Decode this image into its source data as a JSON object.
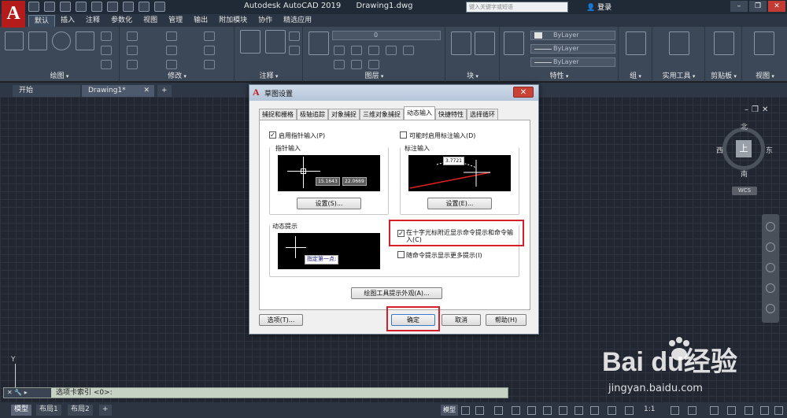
{
  "app": {
    "title_app": "Autodesk AutoCAD 2019",
    "title_file": "Drawing1.dwg",
    "search_placeholder": "键入关键字或短语",
    "login": "登录"
  },
  "ribbon_tabs": [
    "默认",
    "插入",
    "注释",
    "参数化",
    "视图",
    "管理",
    "输出",
    "附加模块",
    "协作",
    "精选应用"
  ],
  "ribbon_panels": {
    "draw": "绘图",
    "modify": "修改",
    "annotation": "注释",
    "layers": "图层",
    "block": "块",
    "properties": "特性",
    "groups": "组",
    "utilities": "实用工具",
    "clipboard": "剪贴板",
    "view": "视图",
    "layer_value": "0",
    "bylayer": "ByLayer"
  },
  "doc_tabs": {
    "start": "开始",
    "drawing": "Drawing1*"
  },
  "viewcube": {
    "face": "上",
    "north": "北",
    "south": "南",
    "east": "东",
    "west": "西",
    "wcs": "WCS"
  },
  "ucs": {
    "y": "Y"
  },
  "command": {
    "text": "选项卡索引 <0>:"
  },
  "layout_tabs": [
    "模型",
    "布局1",
    "布局2"
  ],
  "status": {
    "model": "模型",
    "scale": "1:1"
  },
  "dialog": {
    "title": "草图设置",
    "tabs": [
      "捕捉和栅格",
      "极轴追踪",
      "对象捕捉",
      "三维对象捕捉",
      "动态输入",
      "快捷特性",
      "选择循环"
    ],
    "enable_pointer": "启用指针输入(P)",
    "enable_dim": "可能时启用标注输入(D)",
    "pointer_group": "指针输入",
    "dim_group": "标注输入",
    "pointer_vals": [
      "15.1643",
      "22.0669"
    ],
    "dim_val": "3.7721",
    "settings_s": "设置(S)...",
    "settings_e": "设置(E)...",
    "prompt_group": "动态提示",
    "prompt_tip": "指定第一点:",
    "show_near_cursor": "在十字光标附近显示命令提示和命令输入(C)",
    "show_more": "随命令提示显示更多提示(I)",
    "appearance_btn": "绘图工具提示外观(A)...",
    "options_btn": "选项(T)...",
    "ok_btn": "确定",
    "cancel_btn": "取消",
    "help_btn": "帮助(H)"
  },
  "watermark": {
    "logo": "Bai  du经验",
    "url": "jingyan.baidu.com"
  }
}
